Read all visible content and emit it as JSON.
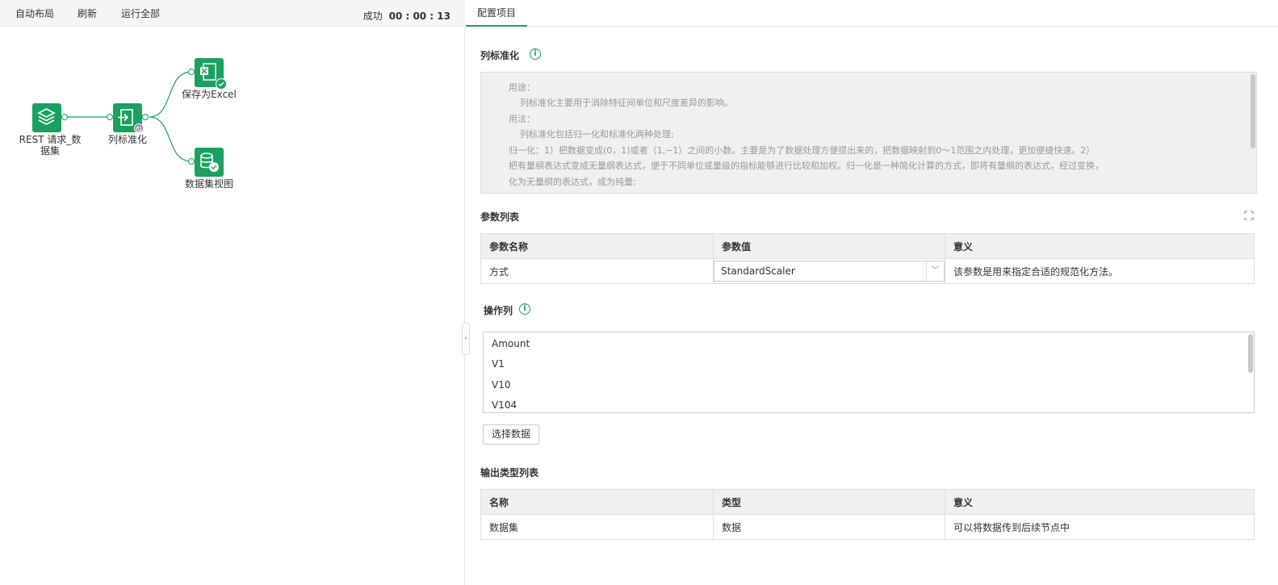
{
  "toolbar": {
    "auto_layout": "自动布局",
    "refresh": "刷新",
    "run_all": "运行全部",
    "status_label": "成功",
    "status_time": "00 : 00 : 13"
  },
  "workflow": {
    "nodes": [
      {
        "label_line1": "REST 请求_数",
        "label_line2": "据集",
        "icon": "layers-icon"
      },
      {
        "label": "列标准化",
        "icon": "transform-icon",
        "badge": "disabled-badge-icon"
      },
      {
        "label": "保存为Excel",
        "icon": "excel-icon",
        "badge": "success-check-icon"
      },
      {
        "label": "数据集视图",
        "icon": "database-icon"
      }
    ],
    "accent_color": "#1aa15f"
  },
  "tabs": {
    "config": "配置项目"
  },
  "description": {
    "title": "列标准化",
    "lines": [
      "用途：",
      "列标准化主要用于消除特征间单位和尺度差异的影响。",
      "用法：",
      "列标准化包括归一化和标准化两种处理;",
      "归一化：1）把数据变成(0，1)或者（1,−1）之间的小数。主要是为了数据处理方便提出来的，把数据映射到0～1范围之内处理，更加便捷快速。2）",
      "把有量纲表达式变成无量纲表达式，便于不同单位或量级的指标能够进行比较和加权。归一化是一种简化计算的方式，即将有量纲的表达式，经过变换，",
      "化为无量纲的表达式，成为纯量;"
    ]
  },
  "params": {
    "title": "参数列表",
    "headers": [
      "参数名称",
      "参数值",
      "意义"
    ],
    "rows": [
      {
        "name": "方式",
        "value": "StandardScaler",
        "meaning": "该参数是用来指定合适的规范化方法。"
      }
    ]
  },
  "operation_columns": {
    "title": "操作列",
    "items": [
      "Amount",
      "V1",
      "V10",
      "V104"
    ],
    "select_button": "选择数据"
  },
  "output_types": {
    "title": "输出类型列表",
    "headers": [
      "名称",
      "类型",
      "意义"
    ],
    "rows": [
      {
        "name": "数据集",
        "type": "数据",
        "meaning": "可以将数据传到后续节点中"
      }
    ]
  }
}
